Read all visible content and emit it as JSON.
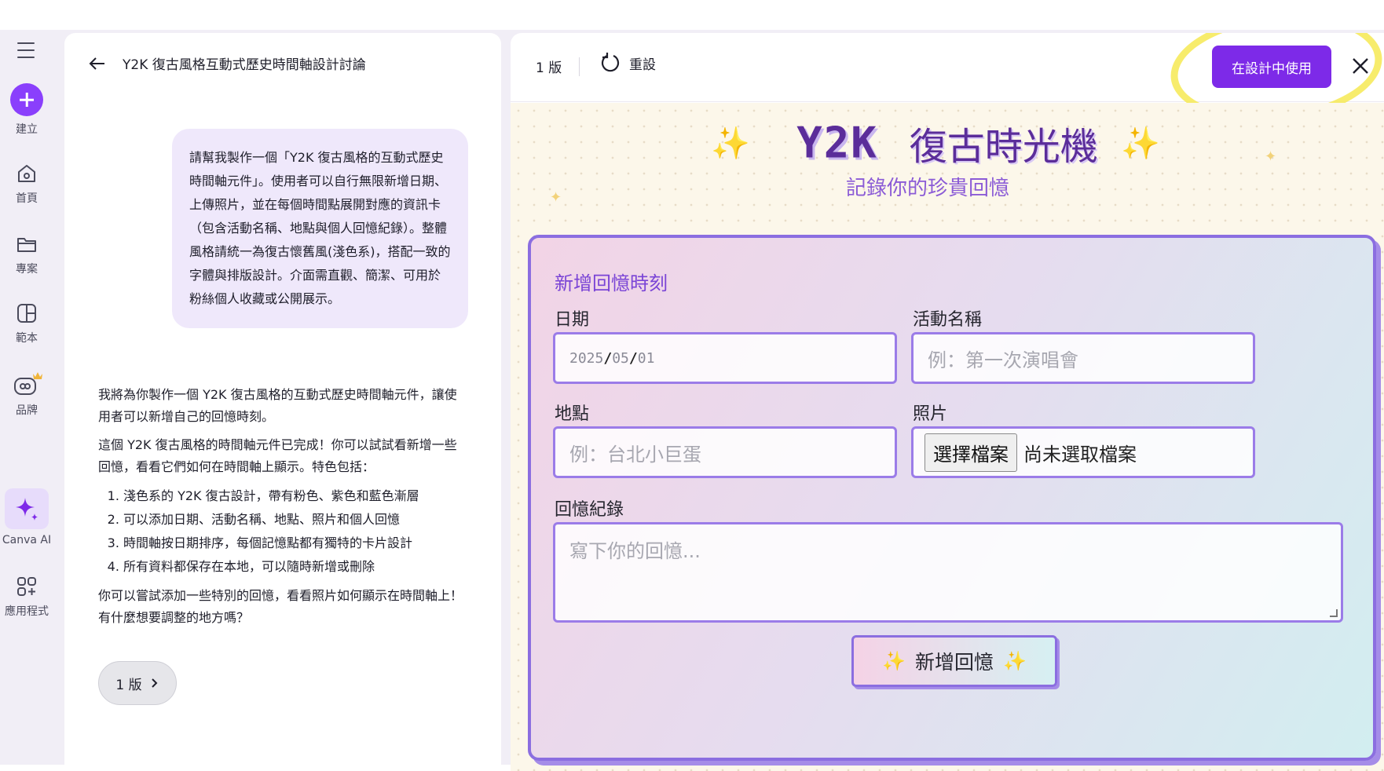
{
  "rail": {
    "items": [
      {
        "label": "建立"
      },
      {
        "label": "首頁"
      },
      {
        "label": "專案"
      },
      {
        "label": "範本"
      },
      {
        "label": "品牌"
      },
      {
        "label": "Canva AI"
      },
      {
        "label": "應用程式"
      }
    ]
  },
  "chat": {
    "title": "Y2K 復古風格互動式歷史時間軸設計討論",
    "user_message": "請幫我製作一個「Y2K 復古風格的互動式歷史時間軸元件」。使用者可以自行無限新增日期、上傳照片，並在每個時間點展開對應的資訊卡（包含活動名稱、地點與個人回憶紀錄）。整體風格請統一為復古懷舊風(淺色系)，搭配一致的字體與排版設計。介面需直觀、簡潔、可用於粉絲個人收藏或公開展示。",
    "reply_p1": "我將為你製作一個 Y2K 復古風格的互動式歷史時間軸元件，讓使用者可以新增自己的回憶時刻。",
    "reply_p2": "這個 Y2K 復古風格的時間軸元件已完成！你可以試試看新增一些回憶，看看它們如何在時間軸上顯示。特色包括：",
    "features": [
      "淺色系的 Y2K 復古設計，帶有粉色、紫色和藍色漸層",
      "可以添加日期、活動名稱、地點、照片和個人回憶",
      "時間軸按日期排序，每個記憶點都有獨特的卡片設計",
      "所有資料都保存在本地，可以隨時新增或刪除"
    ],
    "reply_p3": "你可以嘗試添加一些特別的回憶，看看照片如何顯示在時間軸上！有什麼想要調整的地方嗎？",
    "version_pill": "1 版"
  },
  "preview": {
    "version": "1 版",
    "reset": "重設",
    "use_in_design": "在設計中使用",
    "hero_y2k": "Y2K",
    "hero_title": "復古時光機",
    "tagline": "記錄你的珍貴回憶",
    "form": {
      "title": "新增回憶時刻",
      "date_label": "日期",
      "date_year": "2025",
      "date_month": "05",
      "date_day": "01",
      "event_label": "活動名稱",
      "event_placeholder": "例：第一次演唱會",
      "place_label": "地點",
      "place_placeholder": "例：台北小巨蛋",
      "photo_label": "照片",
      "file_button": "選擇檔案",
      "file_none": "尚未選取檔案",
      "memory_label": "回憶紀錄",
      "memory_placeholder": "寫下你的回憶...",
      "submit": "新增回憶"
    }
  },
  "colors": {
    "accent": "#7d2ae8",
    "rail_bg": "#f1eef6",
    "card_border": "#8b6ee0",
    "highlight": "#f6ea5c"
  }
}
